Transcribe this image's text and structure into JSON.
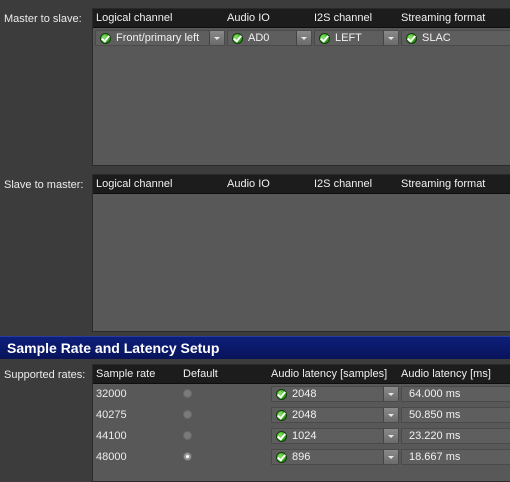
{
  "master_to_slave": {
    "label": "Master to slave:",
    "headers": [
      "Logical channel",
      "Audio IO",
      "I2S channel",
      "Streaming format"
    ],
    "rows": [
      {
        "logical_channel": "Front/primary left",
        "audio_io": "AD0",
        "i2s_channel": "LEFT",
        "streaming_format": "SLAC"
      }
    ]
  },
  "slave_to_master": {
    "label": "Slave to master:",
    "headers": [
      "Logical channel",
      "Audio IO",
      "I2S channel",
      "Streaming format"
    ]
  },
  "section_title": "Sample Rate and Latency Setup",
  "rates": {
    "label": "Supported rates:",
    "headers": [
      "Sample rate",
      "Default",
      "Audio latency [samples]",
      "Audio latency [ms]"
    ],
    "rows": [
      {
        "sample_rate": "32000",
        "default": false,
        "latency_samples": "2048",
        "latency_ms": "64.000 ms"
      },
      {
        "sample_rate": "40275",
        "default": false,
        "latency_samples": "2048",
        "latency_ms": "50.850 ms"
      },
      {
        "sample_rate": "44100",
        "default": false,
        "latency_samples": "1024",
        "latency_ms": "23.220 ms"
      },
      {
        "sample_rate": "48000",
        "default": true,
        "latency_samples": "896",
        "latency_ms": "18.667 ms"
      }
    ]
  },
  "icons": {
    "valid": "green-check-icon",
    "dropdown": "chevron-down-icon"
  },
  "colors": {
    "section_bar": "#0d1f7a",
    "valid": "#2d9d18"
  }
}
